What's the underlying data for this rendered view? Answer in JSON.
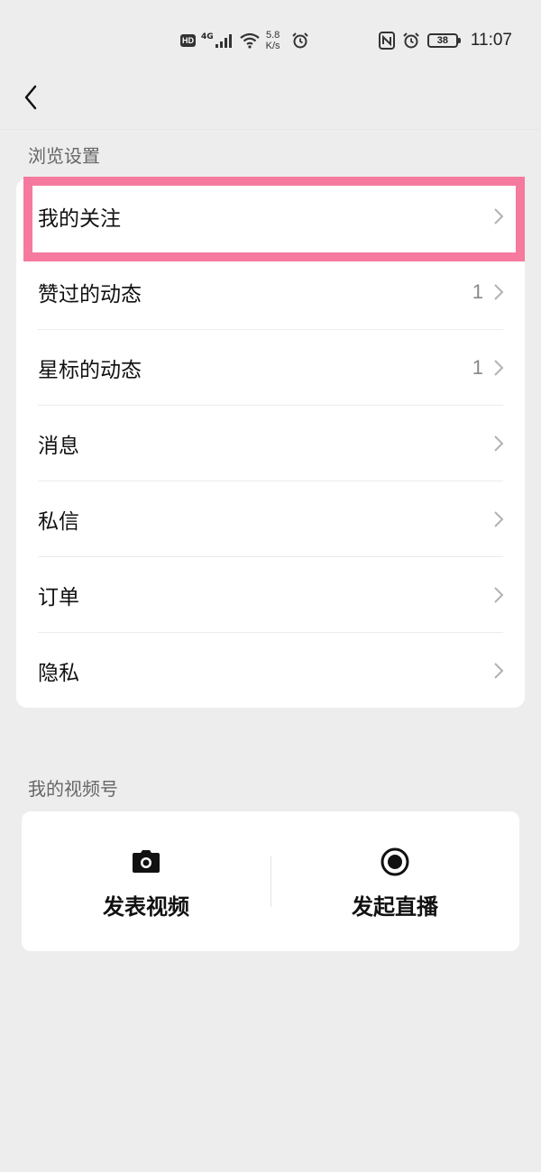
{
  "status_bar": {
    "hd": "HD",
    "network": "4G",
    "speed_value": "5.8",
    "speed_unit": "K/s",
    "battery": "38",
    "time": "11:07"
  },
  "sections": {
    "browse_title": "浏览设置",
    "channel_title": "我的视频号"
  },
  "list": [
    {
      "label": "我的关注",
      "count": ""
    },
    {
      "label": "赞过的动态",
      "count": "1"
    },
    {
      "label": "星标的动态",
      "count": "1"
    },
    {
      "label": "消息",
      "count": ""
    },
    {
      "label": "私信",
      "count": ""
    },
    {
      "label": "订单",
      "count": ""
    },
    {
      "label": "隐私",
      "count": ""
    }
  ],
  "channel": {
    "publish_video": "发表视频",
    "start_live": "发起直播"
  },
  "colors": {
    "highlight": "#f57a9d",
    "background": "#ededed"
  }
}
